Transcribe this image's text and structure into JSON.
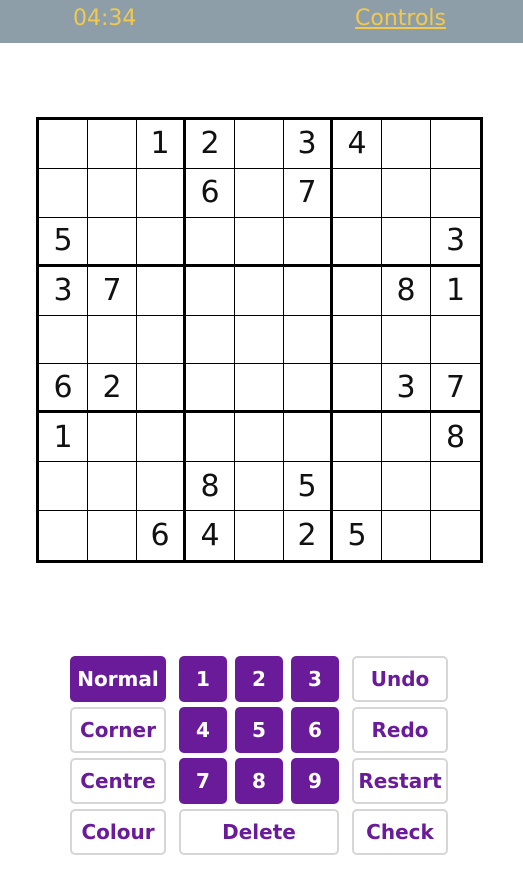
{
  "header": {
    "timer": "04:34",
    "controls_label": "Controls"
  },
  "colors": {
    "accent": "#6a1b9a",
    "header_bg": "#8d9ea9",
    "header_text": "#f2c94c"
  },
  "grid": [
    [
      "",
      "",
      "1",
      "2",
      "",
      "3",
      "4",
      "",
      ""
    ],
    [
      "",
      "",
      "",
      "6",
      "",
      "7",
      "",
      "",
      ""
    ],
    [
      "5",
      "",
      "",
      "",
      "",
      "",
      "",
      "",
      "3"
    ],
    [
      "3",
      "7",
      "",
      "",
      "",
      "",
      "",
      "8",
      "1"
    ],
    [
      "",
      "",
      "",
      "",
      "",
      "",
      "",
      "",
      ""
    ],
    [
      "6",
      "2",
      "",
      "",
      "",
      "",
      "",
      "3",
      "7"
    ],
    [
      "1",
      "",
      "",
      "",
      "",
      "",
      "",
      "",
      "8"
    ],
    [
      "",
      "",
      "",
      "8",
      "",
      "5",
      "",
      "",
      ""
    ],
    [
      "",
      "",
      "6",
      "4",
      "",
      "2",
      "5",
      "",
      ""
    ]
  ],
  "modes": {
    "normal": "Normal",
    "corner": "Corner",
    "centre": "Centre",
    "colour": "Colour"
  },
  "digits": [
    "1",
    "2",
    "3",
    "4",
    "5",
    "6",
    "7",
    "8",
    "9"
  ],
  "actions": {
    "delete": "Delete",
    "undo": "Undo",
    "redo": "Redo",
    "restart": "Restart",
    "check": "Check"
  },
  "active_mode": "Normal"
}
